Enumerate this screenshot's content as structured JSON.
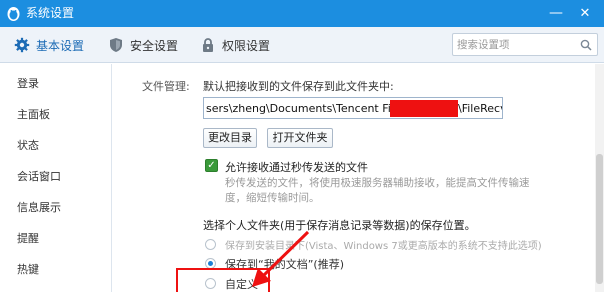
{
  "window": {
    "title": "系统设置",
    "minimize": "—",
    "close": "✕"
  },
  "nav": {
    "tabs": [
      {
        "label": "基本设置",
        "icon": "gear-icon"
      },
      {
        "label": "安全设置",
        "icon": "shield-icon"
      },
      {
        "label": "权限设置",
        "icon": "lock-icon"
      }
    ],
    "search_placeholder": "搜索设置项"
  },
  "sidebar": {
    "items": [
      "登录",
      "主面板",
      "状态",
      "会话窗口",
      "信息展示",
      "提醒",
      "热键"
    ]
  },
  "file_mgmt": {
    "label": "文件管理:",
    "desc": "默认把接收到的文件保存到此文件夹中:",
    "path_prefix": "sers\\zheng\\Documents\\Tencent Files\\",
    "path_suffix": "\\FileRecv\\",
    "btn_change": "更改目录",
    "btn_open": "打开文件夹"
  },
  "fast_transfer": {
    "label": "允许接收通过秒传发送的文件",
    "checked": true,
    "hint_line1": "秒传发送的文件，将使用极速服务器辅助接收，能提高文件传输速",
    "hint_line2": "度，缩短传输时间。"
  },
  "folder": {
    "label": "选择个人文件夹(用于保存消息记录等数据)的保存位置。",
    "options": [
      {
        "label": "保存到安装目录下(Vista、Windows 7或更高版本的系统不支持此选项)",
        "selected": false,
        "disabled": true
      },
      {
        "label": "保存到“我的文档”(推荐)",
        "selected": true,
        "disabled": false
      },
      {
        "label": "自定义",
        "selected": false,
        "disabled": false
      }
    ]
  },
  "colors": {
    "titlebar": "#1c8ee0",
    "accent": "#1c7fd4",
    "annotation": "#ee1111"
  }
}
